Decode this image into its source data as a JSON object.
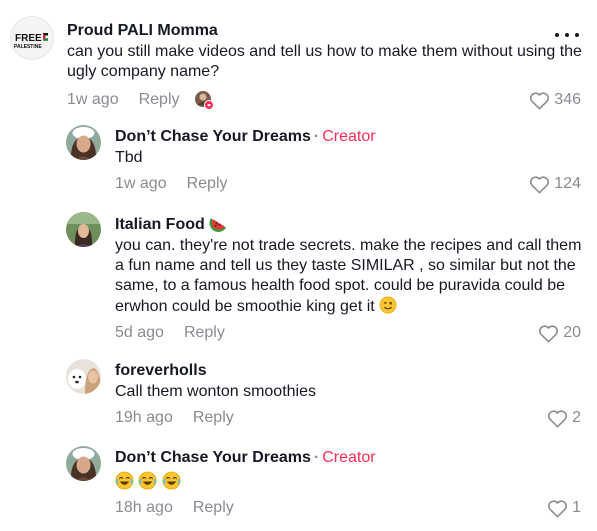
{
  "comments": [
    {
      "username": "Proud PALI Momma",
      "avatar_text_line1": "FREE",
      "avatar_text_line2": "PALESTINE",
      "text": "can you still make videos and tell us how to make them without using the ugly company name?",
      "time": "1w ago",
      "reply_label": "Reply",
      "likes": "346",
      "more_icon": "more-horizontal-icon"
    },
    {
      "username": "Don’t Chase Your Dreams",
      "separator": "·",
      "badge": "Creator",
      "text": "Tbd",
      "time": "1w ago",
      "reply_label": "Reply",
      "likes": "124"
    },
    {
      "username": "Italian Food",
      "username_emoji": "watermelon-emoji",
      "text": "you can. they're not trade secrets. make the recipes and call them a fun name and tell us they taste SIMILAR , so similar but not the same, to a famous health food spot. could be puravida could be erwhon could be smoothie king get it",
      "text_emoji": "wink-emoji",
      "time": "5d ago",
      "reply_label": "Reply",
      "likes": "20"
    },
    {
      "username": "foreverholls",
      "text": "Call them wonton smoothies",
      "time": "19h ago",
      "reply_label": "Reply",
      "likes": "2"
    },
    {
      "username": "Don’t Chase Your Dreams",
      "separator": "·",
      "badge": "Creator",
      "text_emojis": [
        "laughing-emoji",
        "laughing-emoji",
        "laughing-emoji"
      ],
      "time": "18h ago",
      "reply_label": "Reply",
      "likes": "1"
    }
  ],
  "colors": {
    "creator_badge": "#fe2c55",
    "secondary_text": "#8a8b91",
    "primary_text": "#161823"
  }
}
